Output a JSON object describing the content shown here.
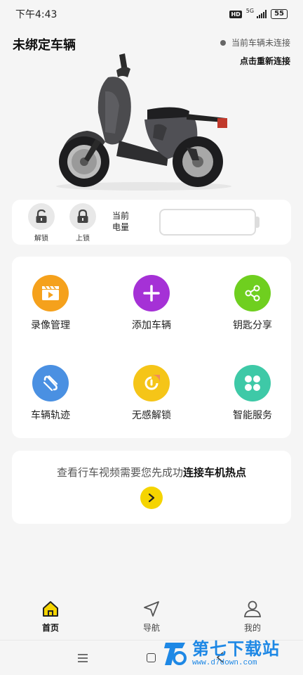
{
  "status_bar": {
    "time": "下午4:43",
    "hd": "HD",
    "network": "5G",
    "battery": "55"
  },
  "header": {
    "title": "未绑定车辆",
    "connection_status": "当前车辆未连接",
    "reconnect": "点击重新连接"
  },
  "lock_panel": {
    "unlock_label": "解锁",
    "lock_label": "上锁",
    "battery_label_line1": "当前",
    "battery_label_line2": "电量",
    "battery_level": 0,
    "accent": "#f0c800"
  },
  "features": [
    {
      "label": "录像管理",
      "icon": "video-clapper-icon",
      "color": "#f5a11c"
    },
    {
      "label": "添加车辆",
      "icon": "plus-icon",
      "color": "#a531d6"
    },
    {
      "label": "钥匙分享",
      "icon": "share-icon",
      "color": "#6fcf1f"
    },
    {
      "label": "车辆轨迹",
      "icon": "track-icon",
      "color": "#4a90e2"
    },
    {
      "label": "无感解锁",
      "icon": "keyless-unlock-icon",
      "color": "#f5c518"
    },
    {
      "label": "智能服务",
      "icon": "clover-icon",
      "color": "#3ec9a7"
    }
  ],
  "video_notice": {
    "prefix": "查看行车视频需要您先成功",
    "highlight": "连接车机热点",
    "button_icon": "chevron-right-icon"
  },
  "tabs": [
    {
      "label": "首页",
      "icon": "home-icon",
      "active": true
    },
    {
      "label": "导航",
      "icon": "navigation-icon",
      "active": false
    },
    {
      "label": "我的",
      "icon": "profile-icon",
      "active": false
    }
  ],
  "watermark": {
    "main": "第七下载站",
    "sub": "www.d7down.com"
  }
}
